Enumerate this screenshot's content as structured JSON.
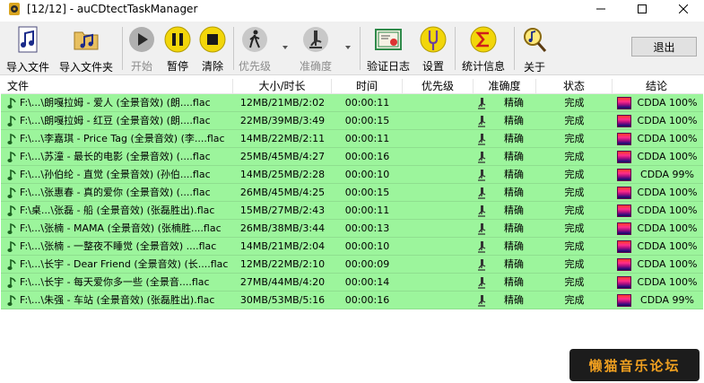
{
  "window": {
    "title": "[12/12] - auCDtectTaskManager",
    "controls": [
      "minimize",
      "maximize",
      "close"
    ]
  },
  "toolbar": {
    "buttons": [
      {
        "label": "导入文件",
        "icon": "music-file-icon",
        "enabled": true
      },
      {
        "label": "导入文件夹",
        "icon": "music-folder-icon",
        "enabled": true
      },
      {
        "label": "开始",
        "icon": "play-icon",
        "enabled": false
      },
      {
        "label": "暂停",
        "icon": "pause-icon",
        "enabled": true
      },
      {
        "label": "清除",
        "icon": "stop-icon",
        "enabled": true
      },
      {
        "label": "优先级",
        "icon": "walking-person-icon",
        "enabled": false
      },
      {
        "label": "准确度",
        "icon": "microscope-icon",
        "enabled": false
      },
      {
        "label": "验证日志",
        "icon": "certificate-icon",
        "enabled": true
      },
      {
        "label": "设置",
        "icon": "tuning-fork-icon",
        "enabled": true
      },
      {
        "label": "统计信息",
        "icon": "sigma-icon",
        "enabled": true
      },
      {
        "label": "关于",
        "icon": "magnifier-note-icon",
        "enabled": true
      }
    ],
    "exit_label": "退出"
  },
  "table": {
    "columns": [
      "文件",
      "大小/时长",
      "时间",
      "优先级",
      "准确度",
      "状态",
      "结论"
    ],
    "rows": [
      {
        "file": "F:\\...\\朗嘎拉姆 - 爱人 (全景音效) (朗....flac",
        "size": "12MB/21MB/2:02",
        "time": "00:00:11",
        "priority": "",
        "accuracy": "精确",
        "status": "完成",
        "verdict": "CDDA 100%"
      },
      {
        "file": "F:\\...\\朗嘎拉姆 - 红豆 (全景音效) (朗....flac",
        "size": "22MB/39MB/3:49",
        "time": "00:00:15",
        "priority": "",
        "accuracy": "精确",
        "status": "完成",
        "verdict": "CDDA 100%"
      },
      {
        "file": "F:\\...\\李嘉琪 - Price Tag (全景音效) (李....flac",
        "size": "14MB/22MB/2:11",
        "time": "00:00:11",
        "priority": "",
        "accuracy": "精确",
        "status": "完成",
        "verdict": "CDDA 100%"
      },
      {
        "file": "F:\\...\\苏潼 - 最长的电影 (全景音效) (....flac",
        "size": "25MB/45MB/4:27",
        "time": "00:00:16",
        "priority": "",
        "accuracy": "精确",
        "status": "完成",
        "verdict": "CDDA 100%"
      },
      {
        "file": "F:\\...\\孙伯纶 - 直觉 (全景音效) (孙伯....flac",
        "size": "14MB/25MB/2:28",
        "time": "00:00:10",
        "priority": "",
        "accuracy": "精确",
        "status": "完成",
        "verdict": "CDDA 99%"
      },
      {
        "file": "F:\\...\\张惠春 - 真的爱你 (全景音效) (....flac",
        "size": "26MB/45MB/4:25",
        "time": "00:00:15",
        "priority": "",
        "accuracy": "精确",
        "status": "完成",
        "verdict": "CDDA 100%"
      },
      {
        "file": "F:\\桌...\\张磊 - 船 (全景音效) (张磊胜出).flac",
        "size": "15MB/27MB/2:43",
        "time": "00:00:11",
        "priority": "",
        "accuracy": "精确",
        "status": "完成",
        "verdict": "CDDA 100%"
      },
      {
        "file": "F:\\...\\张楠 - MAMA (全景音效) (张楠胜....flac",
        "size": "26MB/38MB/3:44",
        "time": "00:00:13",
        "priority": "",
        "accuracy": "精确",
        "status": "完成",
        "verdict": "CDDA 100%"
      },
      {
        "file": "F:\\...\\张楠 - 一整夜不睡觉 (全景音效) ....flac",
        "size": "14MB/21MB/2:04",
        "time": "00:00:10",
        "priority": "",
        "accuracy": "精确",
        "status": "完成",
        "verdict": "CDDA 100%"
      },
      {
        "file": "F:\\...\\长宇 - Dear Friend (全景音效) (长....flac",
        "size": "12MB/22MB/2:10",
        "time": "00:00:09",
        "priority": "",
        "accuracy": "精确",
        "status": "完成",
        "verdict": "CDDA 100%"
      },
      {
        "file": "F:\\...\\长宇 - 每天爱你多一些 (全景音....flac",
        "size": "27MB/44MB/4:20",
        "time": "00:00:14",
        "priority": "",
        "accuracy": "精确",
        "status": "完成",
        "verdict": "CDDA 100%"
      },
      {
        "file": "F:\\...\\朱强 - 车站 (全景音效) (张磊胜出).flac",
        "size": "30MB/53MB/5:16",
        "time": "00:00:16",
        "priority": "",
        "accuracy": "精确",
        "status": "完成",
        "verdict": "CDDA 99%"
      }
    ]
  },
  "watermark": "懒猫音乐论坛",
  "colors": {
    "row_bg": "#9cf59c",
    "toolbar_bg": "#f0f0f0",
    "watermark_text": "#f0a020"
  }
}
